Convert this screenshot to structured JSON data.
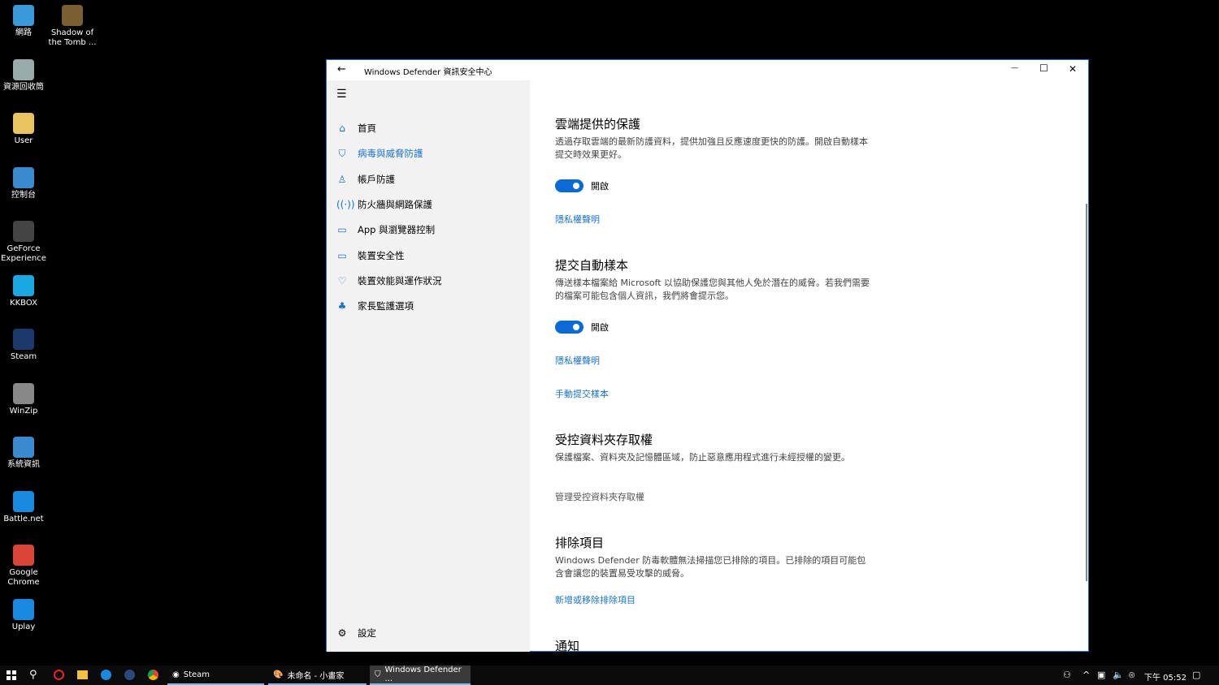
{
  "desktop": {
    "icons": [
      {
        "label": "網路",
        "color": "#3a9ad9"
      },
      {
        "label": "資源回收筒",
        "color": "#9aa"
      },
      {
        "label": "User",
        "color": "#e8c460"
      },
      {
        "label": "控制台",
        "color": "#3a8ad0"
      },
      {
        "label": "GeForce Experience",
        "color": "#444"
      },
      {
        "label": "KKBOX",
        "color": "#19a8e0"
      },
      {
        "label": "Steam",
        "color": "#1b3a6b"
      },
      {
        "label": "WinZip",
        "color": "#888"
      },
      {
        "label": "系統資訊",
        "color": "#3a8ad0"
      },
      {
        "label": "Battle.net",
        "color": "#1a8ae0"
      },
      {
        "label": "Google Chrome",
        "color": "#db4437"
      },
      {
        "label": "Uplay",
        "color": "#1a8ae0"
      }
    ],
    "icons2": [
      {
        "label": "Shadow of the Tomb ...",
        "color": "#7a6030"
      }
    ]
  },
  "window": {
    "title": "Windows Defender 資訊安全中心",
    "back": "←",
    "minimize": "—",
    "maximize": "☐",
    "close": "✕"
  },
  "sidebar": {
    "menu": "☰",
    "items": [
      {
        "label": "首頁",
        "icon": "⌂"
      },
      {
        "label": "病毒與威脅防護",
        "icon": "⛉"
      },
      {
        "label": "帳戶防護",
        "icon": "♙"
      },
      {
        "label": "防火牆與網路保護",
        "icon": "((·))"
      },
      {
        "label": "App 與瀏覽器控制",
        "icon": "▭"
      },
      {
        "label": "裝置安全性",
        "icon": "▭"
      },
      {
        "label": "裝置效能與運作狀況",
        "icon": "♡"
      },
      {
        "label": "家長監護選項",
        "icon": "♣"
      }
    ],
    "settings": {
      "label": "設定",
      "icon": "⚙"
    }
  },
  "main": {
    "cloud": {
      "title": "雲端提供的保護",
      "desc": "透過存取雲端的最新防護資料，提供加強且反應速度更快的防護。開啟自動樣本提交時效果更好。",
      "toggle": "開啟",
      "toggle_on": true,
      "link": "隱私權聲明"
    },
    "sample": {
      "title": "提交自動樣本",
      "desc": "傳送樣本檔案給 Microsoft 以協助保護您與其他人免於潛在的威脅。若我們需要的檔案可能包含個人資訊，我們將會提示您。",
      "toggle": "開啟",
      "toggle_on": true,
      "link": "隱私權聲明",
      "link2": "手動提交樣本"
    },
    "folder": {
      "title": "受控資料夾存取權",
      "desc": "保護檔案、資料夾及記憶體區域，防止惡意應用程式進行未經授權的變更。",
      "link": "管理受控資料夾存取權"
    },
    "exclusions": {
      "title": "排除項目",
      "desc": "Windows Defender 防毒軟體無法掃描您已排除的項目。已排除的項目可能包含會讓您的裝置易受攻擊的威脅。",
      "link": "新增或移除排除項目"
    },
    "notify": {
      "title": "通知"
    }
  },
  "taskbar": {
    "apps": [
      {
        "label": "Steam"
      },
      {
        "label": "未命名 - 小畫家"
      },
      {
        "label": "Windows Defender ..."
      }
    ],
    "clock": "下午 05:52"
  }
}
